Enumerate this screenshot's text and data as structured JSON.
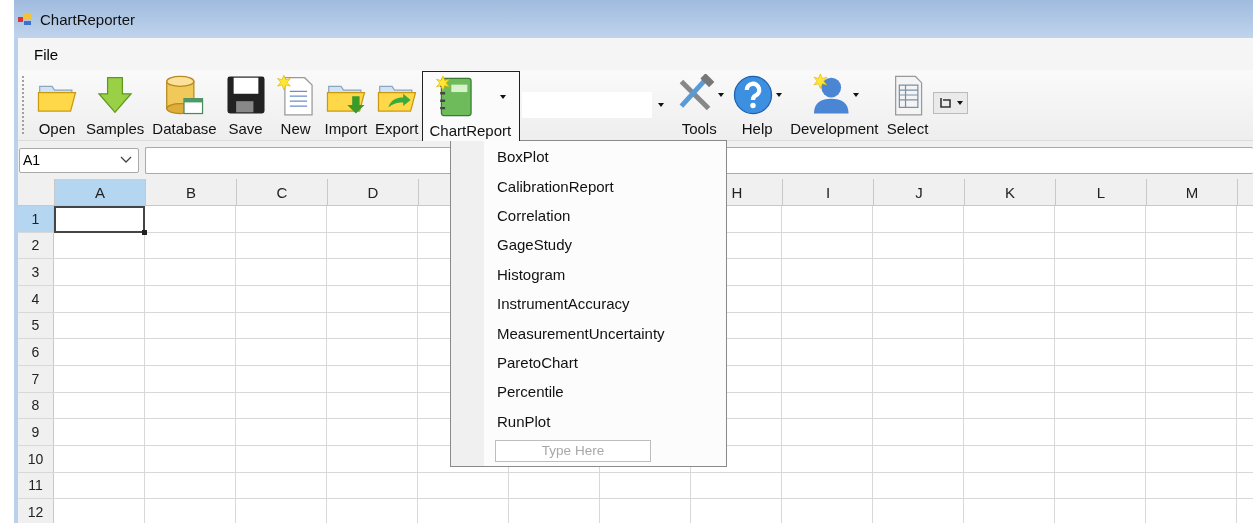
{
  "window": {
    "title": "ChartReporter"
  },
  "menu_bar": [
    {
      "label": "File"
    }
  ],
  "toolbar": [
    {
      "kind": "button",
      "label": "Open",
      "pressed": false
    },
    {
      "kind": "button",
      "label": "Samples",
      "pressed": false
    },
    {
      "kind": "button",
      "label": "Database",
      "pressed": false
    },
    {
      "kind": "button",
      "label": "Save",
      "pressed": false
    },
    {
      "kind": "button",
      "label": "New",
      "pressed": false
    },
    {
      "kind": "button",
      "label": "Import",
      "pressed": false
    },
    {
      "kind": "button",
      "label": "Export",
      "pressed": false
    },
    {
      "kind": "split",
      "label": "ChartReport",
      "pressed": true
    },
    {
      "kind": "combo"
    },
    {
      "kind": "split",
      "label": "Tools",
      "pressed": false
    },
    {
      "kind": "split",
      "label": "Help",
      "pressed": false
    },
    {
      "kind": "split",
      "label": "Development",
      "pressed": false
    },
    {
      "kind": "button",
      "label": "Select",
      "pressed": false
    },
    {
      "kind": "mini"
    }
  ],
  "name_box": {
    "value": "A1"
  },
  "grid": {
    "columns": [
      {
        "label": "A",
        "selected": true
      },
      {
        "label": "B",
        "selected": false
      },
      {
        "label": "C",
        "selected": false
      },
      {
        "label": "D",
        "selected": false
      },
      {},
      {},
      {},
      {
        "label": "H",
        "selected": false
      },
      {
        "label": "I",
        "selected": false
      },
      {
        "label": "J",
        "selected": false
      },
      {
        "label": "K",
        "selected": false
      },
      {
        "label": "L",
        "selected": false
      },
      {
        "label": "M",
        "selected": false
      },
      {}
    ],
    "rows": [
      {
        "label": "1",
        "selected": true
      },
      {
        "label": "2",
        "selected": false
      },
      {
        "label": "3",
        "selected": false
      },
      {
        "label": "4",
        "selected": false
      },
      {
        "label": "5",
        "selected": false
      },
      {
        "label": "6",
        "selected": false
      },
      {
        "label": "7",
        "selected": false
      },
      {
        "label": "8",
        "selected": false
      },
      {
        "label": "9",
        "selected": false
      },
      {
        "label": "10",
        "selected": false
      },
      {
        "label": "11",
        "selected": false
      },
      {
        "label": "12",
        "selected": false
      }
    ]
  },
  "dropdown_menu": {
    "items": [
      {
        "label": "BoxPlot"
      },
      {
        "label": "CalibrationReport"
      },
      {
        "label": "Correlation"
      },
      {
        "label": "GageStudy"
      },
      {
        "label": "Histogram"
      },
      {
        "label": "InstrumentAccuracy"
      },
      {
        "label": "MeasurementUncertainty"
      },
      {
        "label": "ParetoChart"
      },
      {
        "label": "Percentile"
      },
      {
        "label": "RunPlot"
      }
    ],
    "new_item": {
      "placeholder": "Type Here"
    }
  }
}
